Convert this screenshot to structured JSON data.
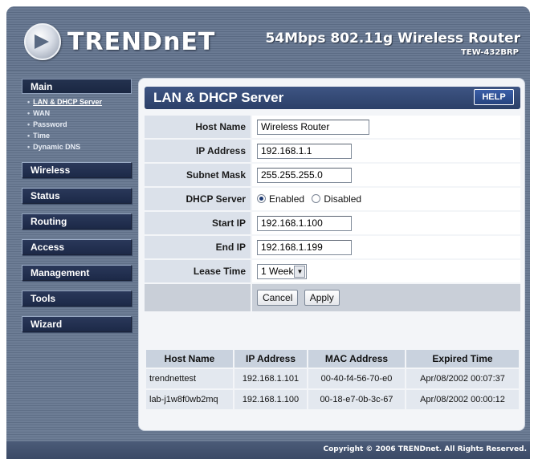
{
  "header": {
    "logo_text": "TRENDnET",
    "product_title": "54Mbps 802.11g Wireless Router",
    "model": "TEW-432BRP"
  },
  "sidebar": {
    "main_label": "Main",
    "submenu": [
      "LAN & DHCP Server",
      "WAN",
      "Password",
      "Time",
      "Dynamic DNS"
    ],
    "active_submenu": "LAN & DHCP Server",
    "nav": [
      "Wireless",
      "Status",
      "Routing",
      "Access",
      "Management",
      "Tools",
      "Wizard"
    ]
  },
  "panel": {
    "title": "LAN & DHCP Server",
    "help_label": "HELP"
  },
  "form": {
    "host_name": {
      "label": "Host Name",
      "value": "Wireless Router"
    },
    "ip_address": {
      "label": "IP Address",
      "value": "192.168.1.1"
    },
    "subnet_mask": {
      "label": "Subnet Mask",
      "value": "255.255.255.0"
    },
    "dhcp_server": {
      "label": "DHCP Server",
      "enabled_label": "Enabled",
      "disabled_label": "Disabled",
      "selected": "Enabled"
    },
    "start_ip": {
      "label": "Start IP",
      "value": "192.168.1.100"
    },
    "end_ip": {
      "label": "End IP",
      "value": "192.168.1.199"
    },
    "lease_time": {
      "label": "Lease Time",
      "value": "1 Week"
    },
    "cancel_label": "Cancel",
    "apply_label": "Apply"
  },
  "lease_table": {
    "columns": [
      "Host Name",
      "IP Address",
      "MAC Address",
      "Expired Time"
    ],
    "rows": [
      [
        "trendnettest",
        "192.168.1.101",
        "00-40-f4-56-70-e0",
        "Apr/08/2002 00:07:37"
      ],
      [
        "lab-j1w8f0wb2mq",
        "192.168.1.100",
        "00-18-e7-0b-3c-67",
        "Apr/08/2002 00:00:12"
      ]
    ]
  },
  "footer": {
    "copyright": "Copyright © 2006 TRENDnet. All Rights Reserved."
  },
  "colors": {
    "frame": "#66768e",
    "nav_button": "#1f2c4a",
    "panel_header": "#33497a",
    "label_cell": "#dbe1ea"
  }
}
